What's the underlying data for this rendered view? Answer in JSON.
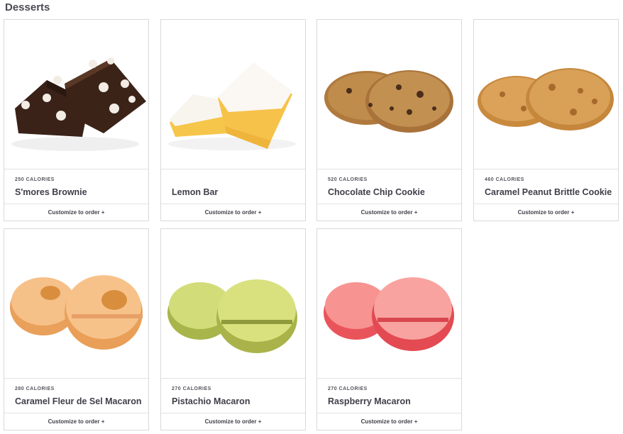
{
  "section": {
    "title": "Desserts"
  },
  "cta_label": "Customize to order +",
  "products": [
    {
      "calories": "250 CALORIES",
      "name": "S'mores Brownie",
      "image_icon": "smores-brownie-image"
    },
    {
      "calories": "",
      "name": "Lemon Bar",
      "image_icon": "lemon-bar-image"
    },
    {
      "calories": "520 CALORIES",
      "name": "Chocolate Chip Cookie",
      "image_icon": "chocolate-chip-cookie-image"
    },
    {
      "calories": "460 CALORIES",
      "name": "Caramel Peanut Brittle Cookie",
      "image_icon": "caramel-peanut-brittle-cookie-image"
    },
    {
      "calories": "280 CALORIES",
      "name": "Caramel Fleur de Sel Macaron",
      "image_icon": "caramel-macaron-image"
    },
    {
      "calories": "270 CALORIES",
      "name": "Pistachio Macaron",
      "image_icon": "pistachio-macaron-image"
    },
    {
      "calories": "270 CALORIES",
      "name": "Raspberry Macaron",
      "image_icon": "raspberry-macaron-image"
    }
  ],
  "colors": {
    "text": "#3f3f4a",
    "border": "#d9d9d9",
    "brownie": "#3a2219",
    "lemon_bar": "#f6c64a",
    "cookie": "#b07a3e",
    "caramel_macaron": "#f3b26a",
    "pistachio_macaron": "#c9d86a",
    "raspberry_macaron": "#f58a86"
  }
}
